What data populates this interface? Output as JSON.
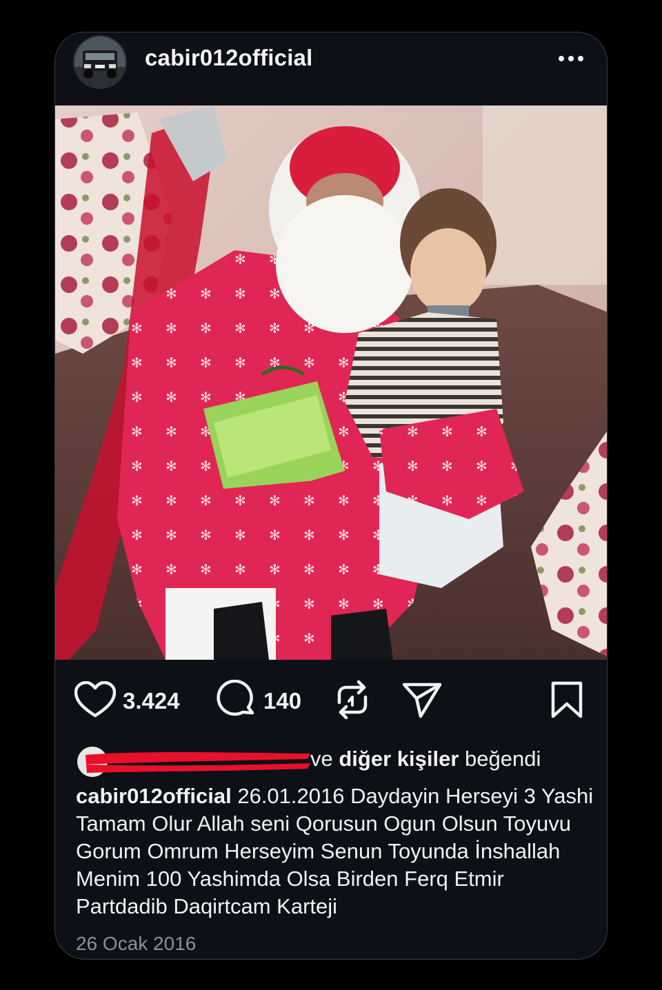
{
  "post": {
    "username": "cabir012official",
    "more_icon": "more-horizontal-icon",
    "likes_count": "3.424",
    "comments_count": "140",
    "liked_by_suffix_plain_before": "ve ",
    "liked_by_bold": "diğer kişiler",
    "liked_by_suffix_plain_after": " beğendi",
    "caption_user": "cabir012official",
    "caption_text": " 26.01.2016 Daydayin Herseyi 3 Yashi Tamam Olur Allah seni Qorusun Ogun Olsun Toyuvu Gorum Omrum Herseyim Senun Toyunda İnshallah Menim 100 Yashimda Olsa Birden Ferq Etmir Partdadib Daqirtcam Karteji",
    "date": "26 Ocak 2016"
  },
  "icons": {
    "like": "heart-icon",
    "comment": "comment-icon",
    "repost": "repost-icon",
    "share": "send-icon",
    "save": "bookmark-icon"
  },
  "colors": {
    "background": "#000000",
    "card": "#0d1016",
    "text": "#f2f2f2",
    "muted": "#8d9096",
    "redaction": "#e8102a"
  }
}
